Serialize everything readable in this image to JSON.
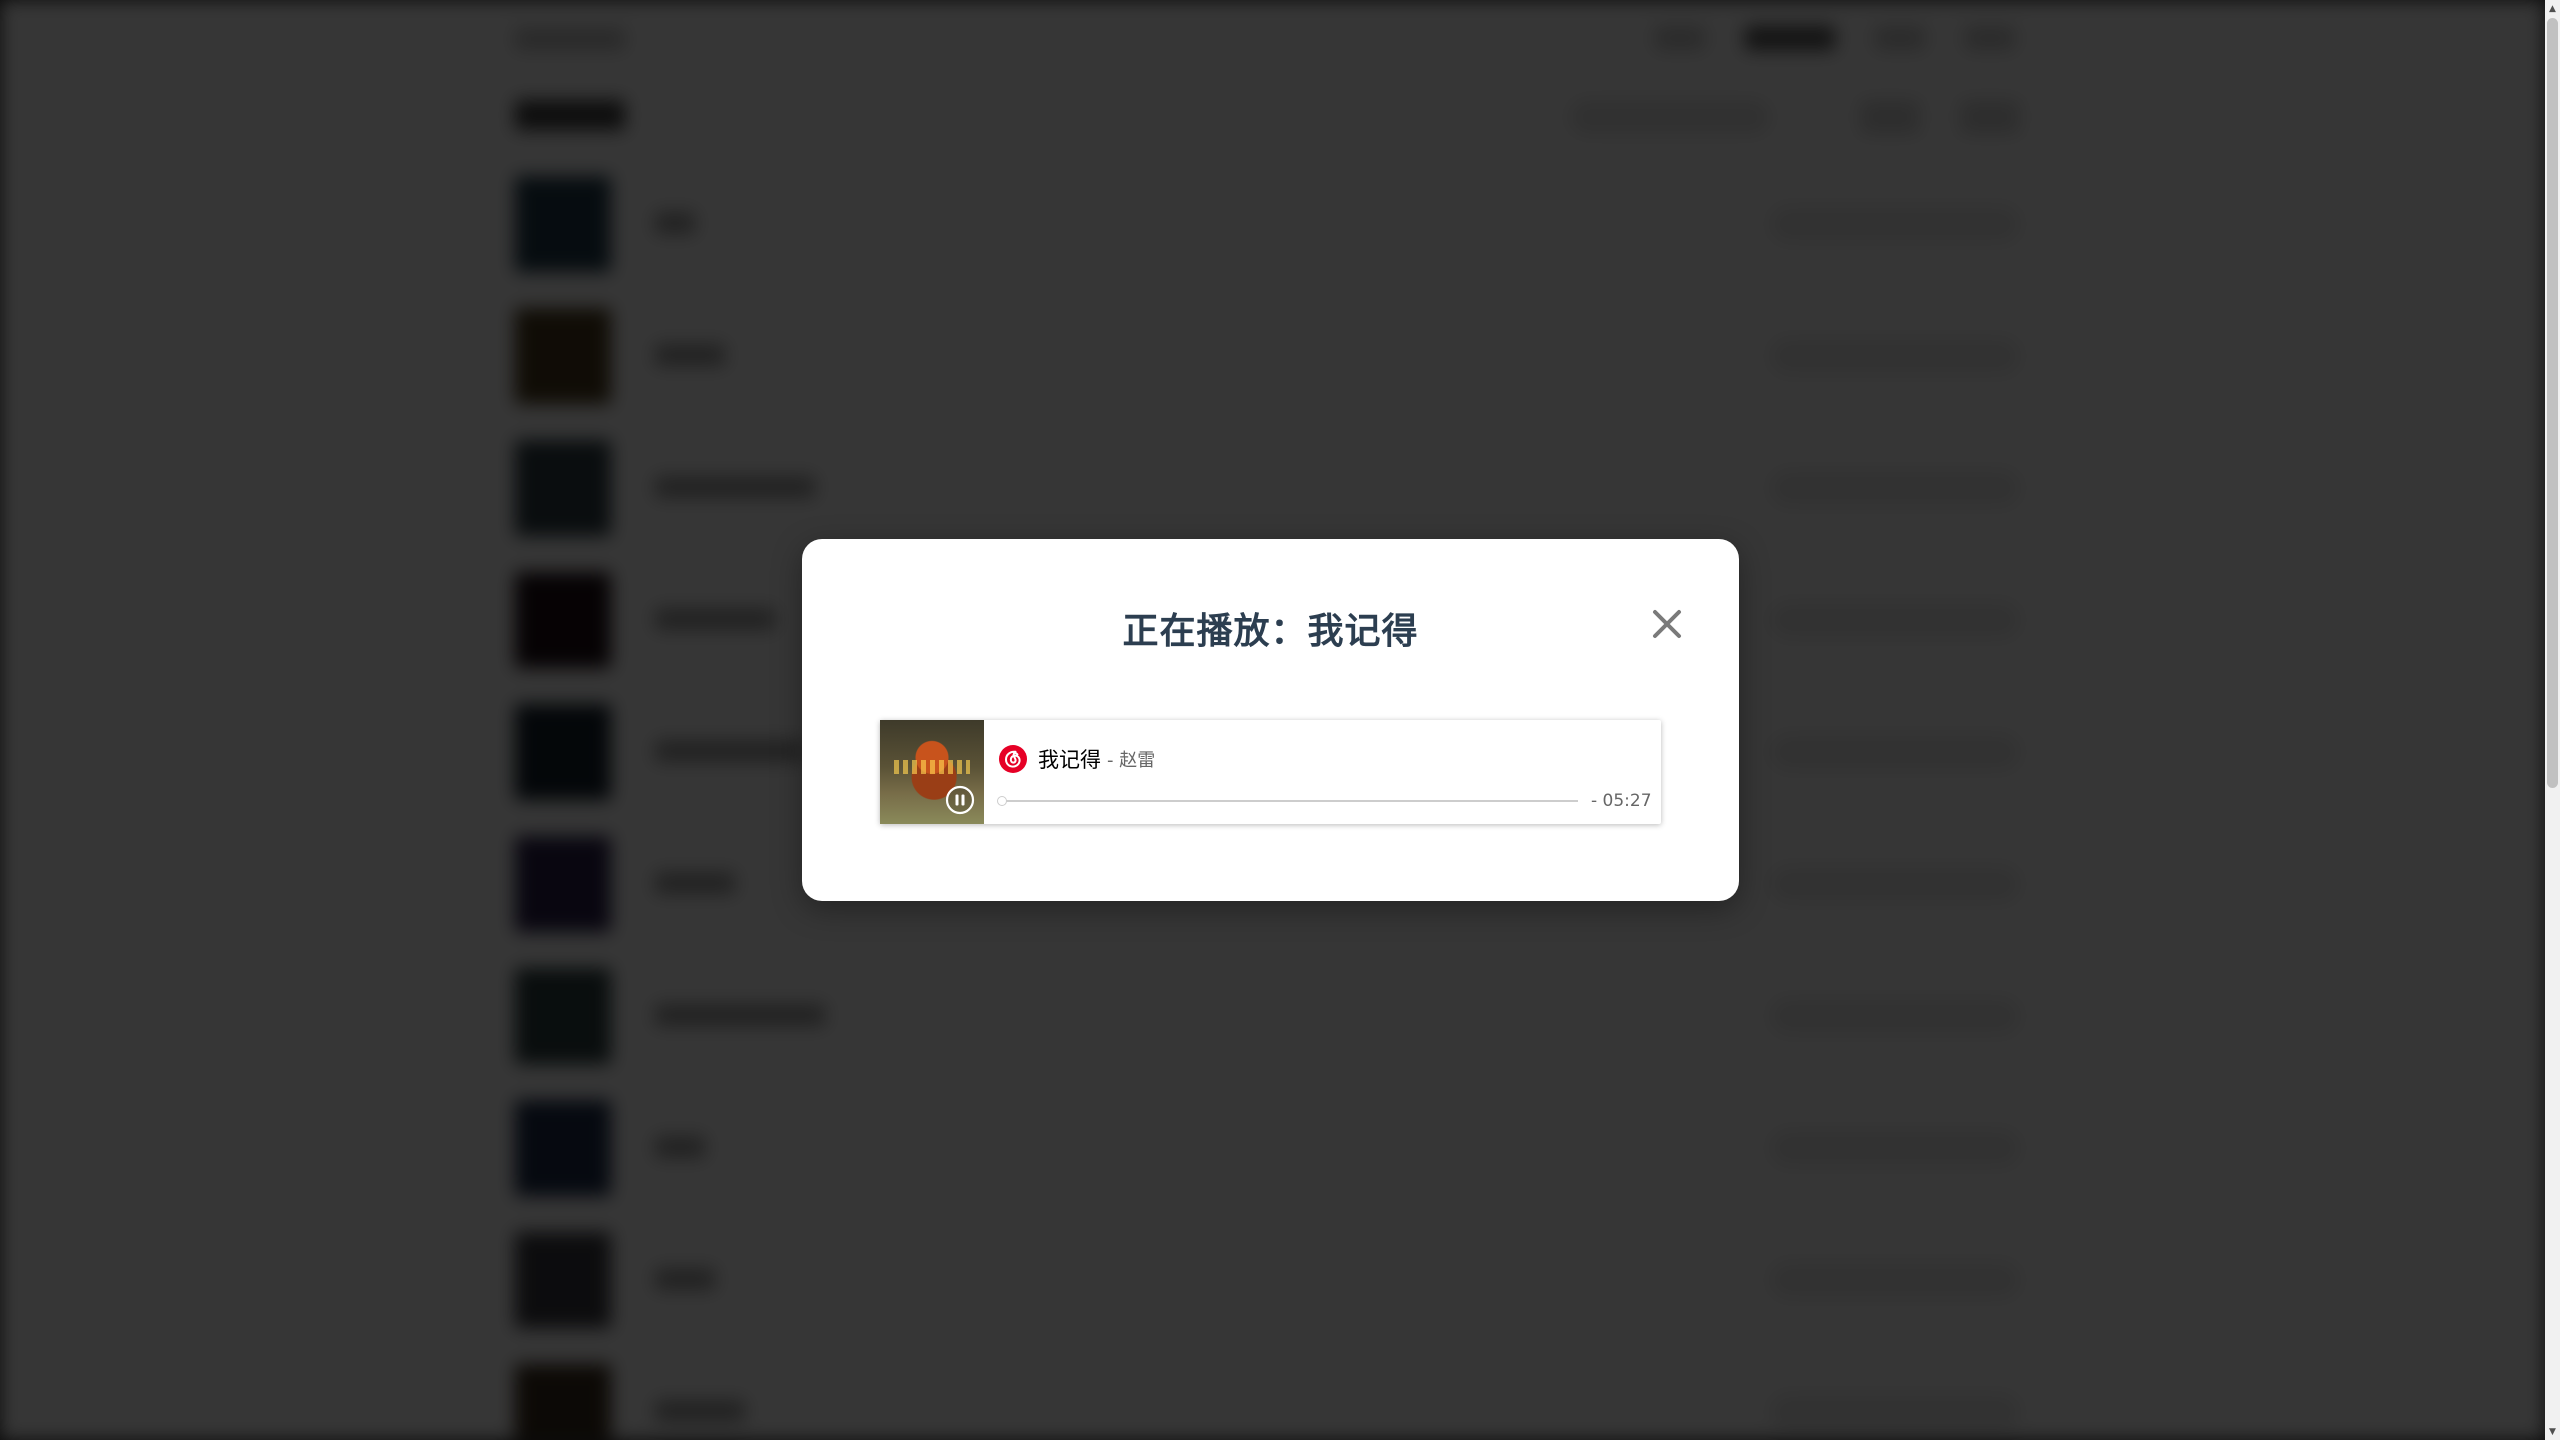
{
  "modal": {
    "title": "正在播放：我记得",
    "close_icon": "close-icon"
  },
  "player": {
    "song_title": "我记得",
    "artist": "- 赵雷",
    "time": "- 05:27",
    "progress": 0,
    "state": "playing",
    "service_icon": "netease-cloud-music-icon",
    "control_icon": "pause-icon",
    "accent_color": "#e60026"
  },
  "background_list": {
    "row_count": 10,
    "thumb_colors": [
      "#1f3a4a",
      "#4a3a1c",
      "#2d3d44",
      "#1c0d14",
      "#13202c",
      "#2a1f4a",
      "#2c3f40",
      "#1c2c4a",
      "#3a3a40",
      "#3a2c1c"
    ]
  },
  "scrollbar": {
    "up_icon": "scroll-up-arrow-icon",
    "down_icon": "scroll-down-arrow-icon"
  }
}
